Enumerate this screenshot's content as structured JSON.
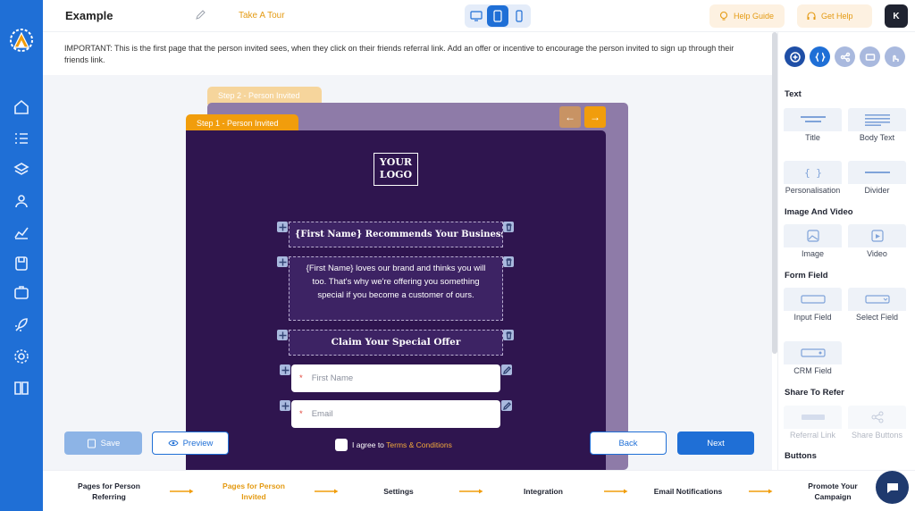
{
  "header": {
    "title": "Example",
    "tour_label": "Take A Tour",
    "help_guide_label": "Help Guide",
    "get_help_label": "Get Help",
    "avatar_initial": "K"
  },
  "notice": "IMPORTANT: This is the first page that the person invited sees, when they click on their friends referral link. Add an offer or incentive to encourage the person invited to sign up through their friends link.",
  "steps": {
    "step2_label": "Step 2 - Person Invited",
    "step1_label": "Step 1 - Person Invited"
  },
  "preview": {
    "logo_line1": "YOUR",
    "logo_line2": "LOGO",
    "headline": "{First Name} Recommends Your Business Name",
    "body": "{First Name} loves our brand and thinks you will too. That's why we're offering you something special if you become a customer of ours.",
    "cta": "Claim Your Special Offer",
    "field_first_name": "First Name",
    "field_email": "Email",
    "required_mark": "*",
    "agree_text": "I agree to",
    "agree_link": "Terms & Conditions"
  },
  "actions": {
    "save": "Save",
    "preview": "Preview",
    "back": "Back",
    "next": "Next"
  },
  "right_panel": {
    "sections": {
      "text": "Text",
      "image_video": "Image And Video",
      "form_field": "Form Field",
      "share": "Share To Refer",
      "buttons": "Buttons"
    },
    "tiles": {
      "title": "Title",
      "body_text": "Body Text",
      "personalisation": "Personalisation",
      "divider": "Divider",
      "image": "Image",
      "video": "Video",
      "input_field": "Input Field",
      "select_field": "Select Field",
      "crm_field": "CRM Field",
      "referral_link": "Referral Link",
      "share_buttons": "Share Buttons"
    }
  },
  "footer_steps": [
    {
      "label": "Pages for Person Referring"
    },
    {
      "label": "Pages for Person Invited"
    },
    {
      "label": "Settings"
    },
    {
      "label": "Integration"
    },
    {
      "label": "Email Notifications"
    },
    {
      "label": "Promote Your Campaign"
    }
  ],
  "colors": {
    "brand_blue": "#1f6fd6",
    "accent_orange": "#f19d0c",
    "preview_purple": "#2f154f"
  }
}
